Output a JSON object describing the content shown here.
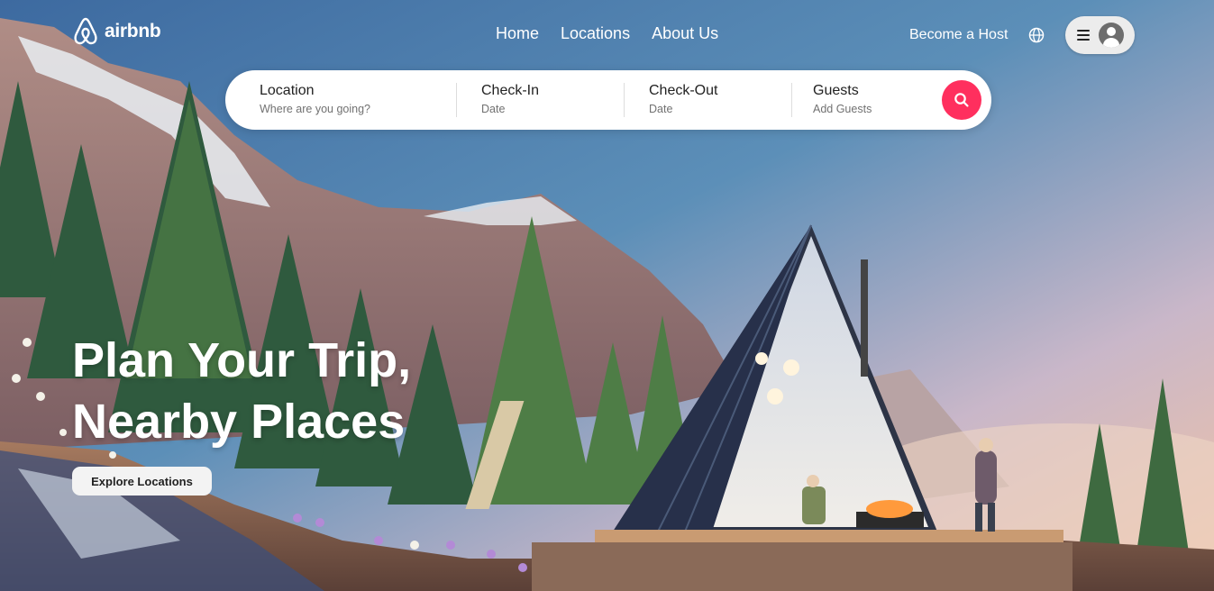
{
  "brand": {
    "name": "airbnb"
  },
  "nav": {
    "items": [
      "Home",
      "Locations",
      "About Us"
    ]
  },
  "header": {
    "become_host": "Become a Host"
  },
  "search": {
    "fields": [
      {
        "label": "Location",
        "placeholder": "Where are you going?"
      },
      {
        "label": "Check-In",
        "placeholder": "Date"
      },
      {
        "label": "Check-Out",
        "placeholder": "Date"
      },
      {
        "label": "Guests",
        "placeholder": "Add Guests"
      }
    ],
    "button_icon": "search-icon",
    "accent": "#ff2f5e"
  },
  "hero": {
    "headline_line1": "Plan Your Trip,",
    "headline_line2": "Nearby Places",
    "cta": "Explore Locations"
  },
  "icons": {
    "logo": "airbnb-logo-icon",
    "globe": "globe-icon",
    "menu": "hamburger-menu-icon",
    "avatar": "user-avatar-icon"
  }
}
